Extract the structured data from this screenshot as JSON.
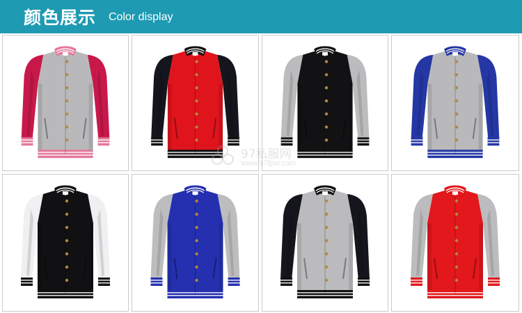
{
  "header": {
    "title_cn": "颜色展示",
    "title_en": "Color display",
    "background": "#1e9ab3"
  },
  "watermark": {
    "text": "97私服网",
    "url": "www.97fpw.com"
  },
  "products": [
    {
      "body": "#b9b9bb",
      "sleeve": "#c8184a",
      "trim": "#e4789a",
      "stripe": "#ffffff",
      "button": "#b08a3c"
    },
    {
      "body": "#e0141c",
      "sleeve": "#15151d",
      "trim": "#111111",
      "stripe": "#ffffff",
      "button": "#b08a3c"
    },
    {
      "body": "#121214",
      "sleeve": "#bcbcbe",
      "trim": "#111111",
      "stripe": "#ffffff",
      "button": "#b08a3c"
    },
    {
      "body": "#b9b9bb",
      "sleeve": "#2437a4",
      "trim": "#2437a4",
      "stripe": "#ffffff",
      "button": "#b08a3c"
    },
    {
      "body": "#111113",
      "sleeve": "#f0f0f2",
      "trim": "#111111",
      "stripe": "#ffffff",
      "button": "#b08a3c"
    },
    {
      "body": "#2430b0",
      "sleeve": "#bdbdbf",
      "trim": "#2430b0",
      "stripe": "#ffffff",
      "button": "#b08a3c"
    },
    {
      "body": "#bbbbbd",
      "sleeve": "#15151d",
      "trim": "#111111",
      "stripe": "#ffffff",
      "button": "#b08a3c"
    },
    {
      "body": "#e2181c",
      "sleeve": "#bcbcbe",
      "trim": "#e2181c",
      "stripe": "#ffffff",
      "button": "#b08a3c"
    }
  ],
  "icons": {
    "product": "varsity-jacket-icon",
    "watermark_logo": "flower-logo-icon"
  }
}
